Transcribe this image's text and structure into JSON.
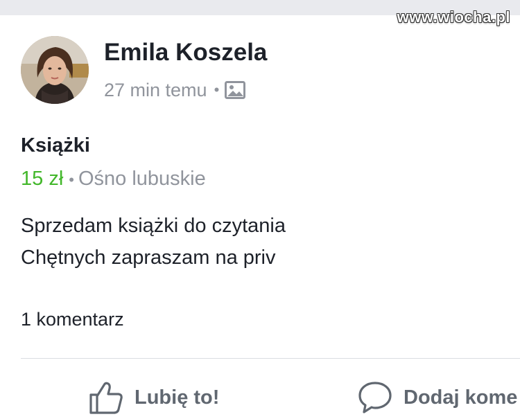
{
  "watermark": "www.wiocha.pl",
  "post": {
    "author_name": "Emila Koszela",
    "time": "27 min temu",
    "meta_separator": "•",
    "privacy_icon": "photo-icon"
  },
  "listing": {
    "title": "Książki",
    "price": "15 zł",
    "separator": "•",
    "location": "Ośno lubuskie",
    "description": [
      "Sprzedam książki do czytania",
      "Chętnych zapraszam na priv"
    ]
  },
  "comments": {
    "count_label": "1 komentarz"
  },
  "actions": {
    "like_label": "Lubię to!",
    "comment_label": "Dodaj kome"
  },
  "colors": {
    "price_green": "#42b72a",
    "secondary_gray": "#90949c",
    "text_dark": "#1d2129",
    "action_gray": "#606770"
  }
}
